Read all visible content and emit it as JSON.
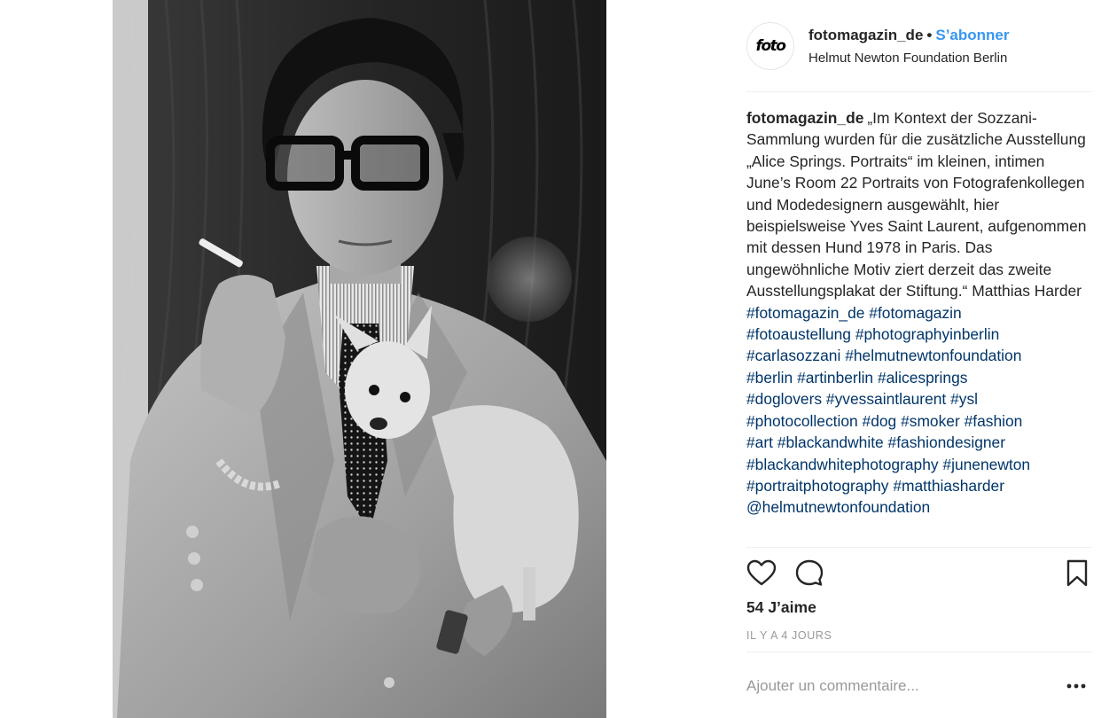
{
  "post": {
    "photo_alt": "Yves Saint Laurent avec un chien"
  },
  "header": {
    "avatar_text": "foto",
    "username": "fotomagazin_de",
    "separator": "•",
    "follow_label": "S’abonner",
    "location": "Helmut Newton Foundation Berlin"
  },
  "caption": {
    "username": "fotomagazin_de",
    "text": "„Im Kontext der Sozzani-Sammlung wurden für die zusätzliche Ausstellung „Alice Springs. Portraits“ im kleinen, intimen June’s Room 22 Portraits von Fotografenkollegen und Modedesignern ausgewählt, hier beispielsweise Yves Saint Laurent, aufgenommen mit dessen Hund 1978 in Paris. Das ungewöhnliche Motiv ziert derzeit das zweite Ausstellungsplakat der Stiftung.“ Matthias Harder",
    "hashtags": [
      [
        "#fotomagazin_de",
        "#fotomagazin"
      ],
      [
        "#fotoaustellung",
        "#photographyinberlin"
      ],
      [
        "#carlasozzani",
        "#helmutnewtonfoundation"
      ],
      [
        "#berlin",
        "#artinberlin",
        "#alicesprings"
      ],
      [
        "#doglovers",
        "#yvessaintlaurent",
        "#ysl"
      ],
      [
        "#photocollection",
        "#dog",
        "#smoker",
        "#fashion"
      ],
      [
        "#art",
        "#blackandwhite",
        "#fashiondesigner"
      ],
      [
        "#blackandwhitephotography",
        "#junenewton"
      ],
      [
        "#portraitphotography",
        "#matthiasharder"
      ],
      [
        "@helmutnewtonfoundation"
      ]
    ],
    "tag_color": "#003569"
  },
  "actions": {
    "like_icon": "heart-icon",
    "comment_icon": "comment-bubble-icon",
    "save_icon": "bookmark-icon"
  },
  "likes_label": "54 J’aime",
  "timestamp": "IL Y A 4 JOURS",
  "comment": {
    "placeholder": "Ajouter un commentaire...",
    "value": "",
    "more_label": "•••"
  },
  "colors": {
    "accent": "#3897f0",
    "text": "#262626",
    "muted": "#999999",
    "divider": "#efefef"
  }
}
